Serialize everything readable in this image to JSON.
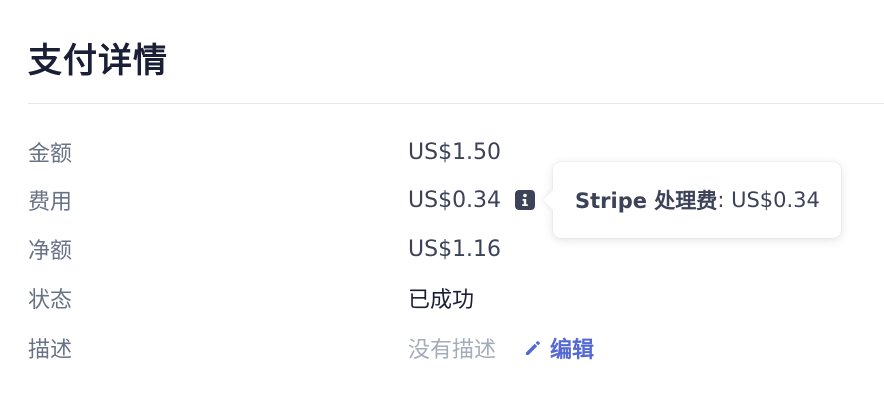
{
  "section": {
    "title": "支付详情"
  },
  "details": {
    "amount": {
      "label": "金额",
      "value": "US$1.50"
    },
    "fee": {
      "label": "费用",
      "value": "US$0.34"
    },
    "net": {
      "label": "净额",
      "value": "US$1.16"
    },
    "status": {
      "label": "状态",
      "value": "已成功"
    },
    "description": {
      "label": "描述",
      "value": "没有描述",
      "edit_label": "编辑"
    }
  },
  "tooltip": {
    "label": "Stripe 处理费",
    "separator": ":",
    "value": "US$0.34"
  },
  "icons": {
    "info": "info-icon",
    "edit": "pencil-icon"
  },
  "colors": {
    "link": "#5469d4",
    "label": "#697386",
    "muted": "#a3acb9",
    "heading": "#1a1f36"
  }
}
